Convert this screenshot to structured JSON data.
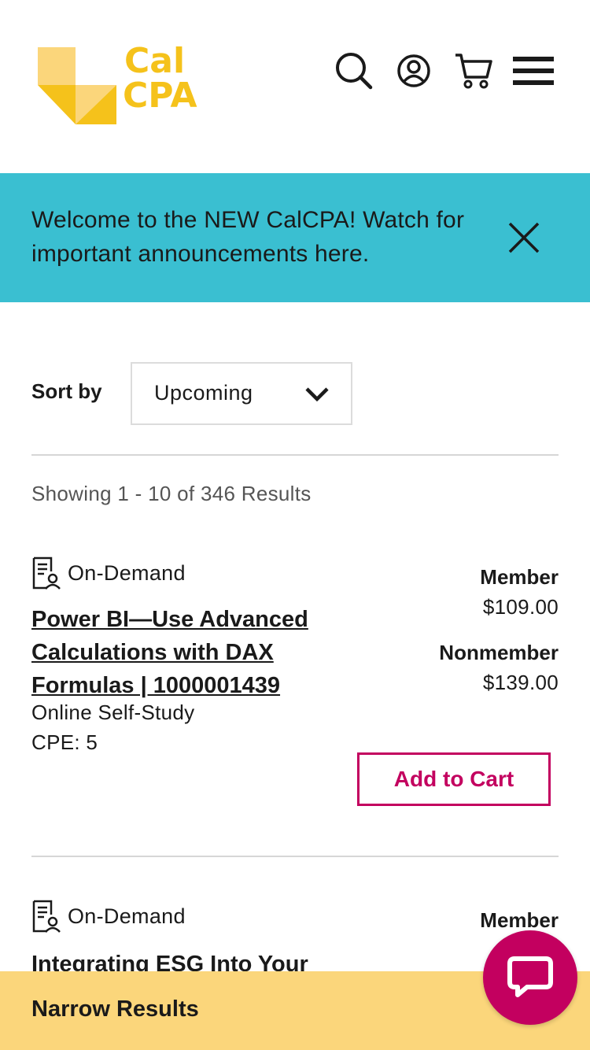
{
  "header": {
    "logo_line1": "Cal",
    "logo_line2": "CPA",
    "icons": [
      "search-icon",
      "account-icon",
      "cart-icon",
      "menu-icon"
    ]
  },
  "announcement": {
    "text": "Welcome to the NEW CalCPA! Watch for important announcements here."
  },
  "sort": {
    "label": "Sort by",
    "selected": "Upcoming"
  },
  "results": {
    "count_text": "Showing 1 - 10 of 346 Results"
  },
  "products": [
    {
      "type": "On-Demand",
      "title": "Power BI—Use Advanced Calculations with DAX Formulas | 1000001439",
      "format": "Online Self-Study",
      "cpe": "CPE: 5",
      "member_label": "Member",
      "member_price": "$109.00",
      "nonmember_label": "Nonmember",
      "nonmember_price": "$139.00",
      "cart_label": "Add to Cart"
    },
    {
      "type": "On-Demand",
      "title": "Integrating ESG Into Your",
      "member_label": "Member"
    }
  ],
  "narrow": {
    "label": "Narrow Results"
  },
  "colors": {
    "brand_yellow": "#f5c21b",
    "announce_bg": "#3abfd1",
    "accent_magenta": "#c3005f",
    "narrow_bg": "#fbd67b"
  }
}
